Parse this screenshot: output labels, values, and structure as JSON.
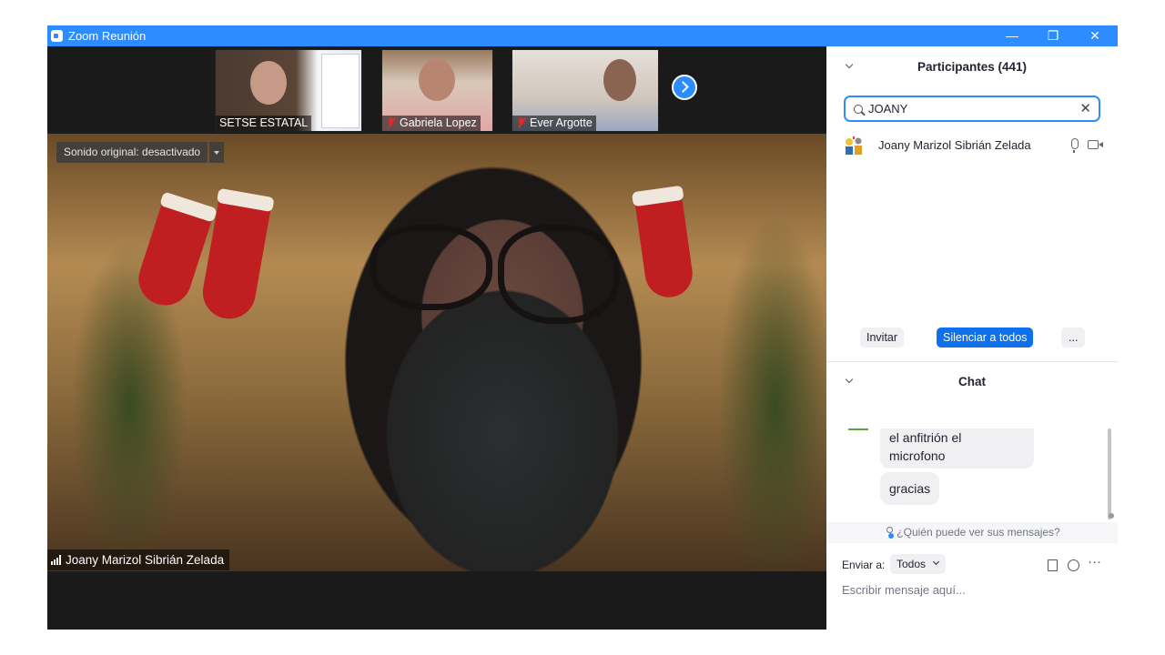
{
  "window": {
    "title": "Zoom Reunión",
    "accent": "#2d8cff",
    "controls": {
      "minimize": "—",
      "restore": "❐",
      "close": "✕"
    }
  },
  "thumbnails": [
    {
      "name": "SETSE ESTATAL",
      "muted": false
    },
    {
      "name": "Gabriela Lopez",
      "muted": true
    },
    {
      "name": "Ever Argotte",
      "muted": true
    }
  ],
  "main_video": {
    "sound_label": "Sonido original: desactivado",
    "speaker_name": "Joany Marizol Sibrián Zelada"
  },
  "participants": {
    "title": "Participantes (441)",
    "search_value": "JOANY",
    "list": [
      {
        "name": "Joany Marizol Sibrián Zelada"
      }
    ],
    "buttons": {
      "invite": "Invitar",
      "mute_all": "Silenciar a todos",
      "more": "..."
    }
  },
  "chat": {
    "title": "Chat",
    "messages": [
      {
        "line1": "el anfitrión el",
        "line2": "microfono"
      },
      {
        "text": "gracias"
      }
    ],
    "who_sees": "¿Quién puede ver sus mensajes?",
    "send_to_label": "Enviar a:",
    "send_to_value": "Todos",
    "placeholder": "Escribir mensaje aquí...",
    "more_tools": "···"
  }
}
